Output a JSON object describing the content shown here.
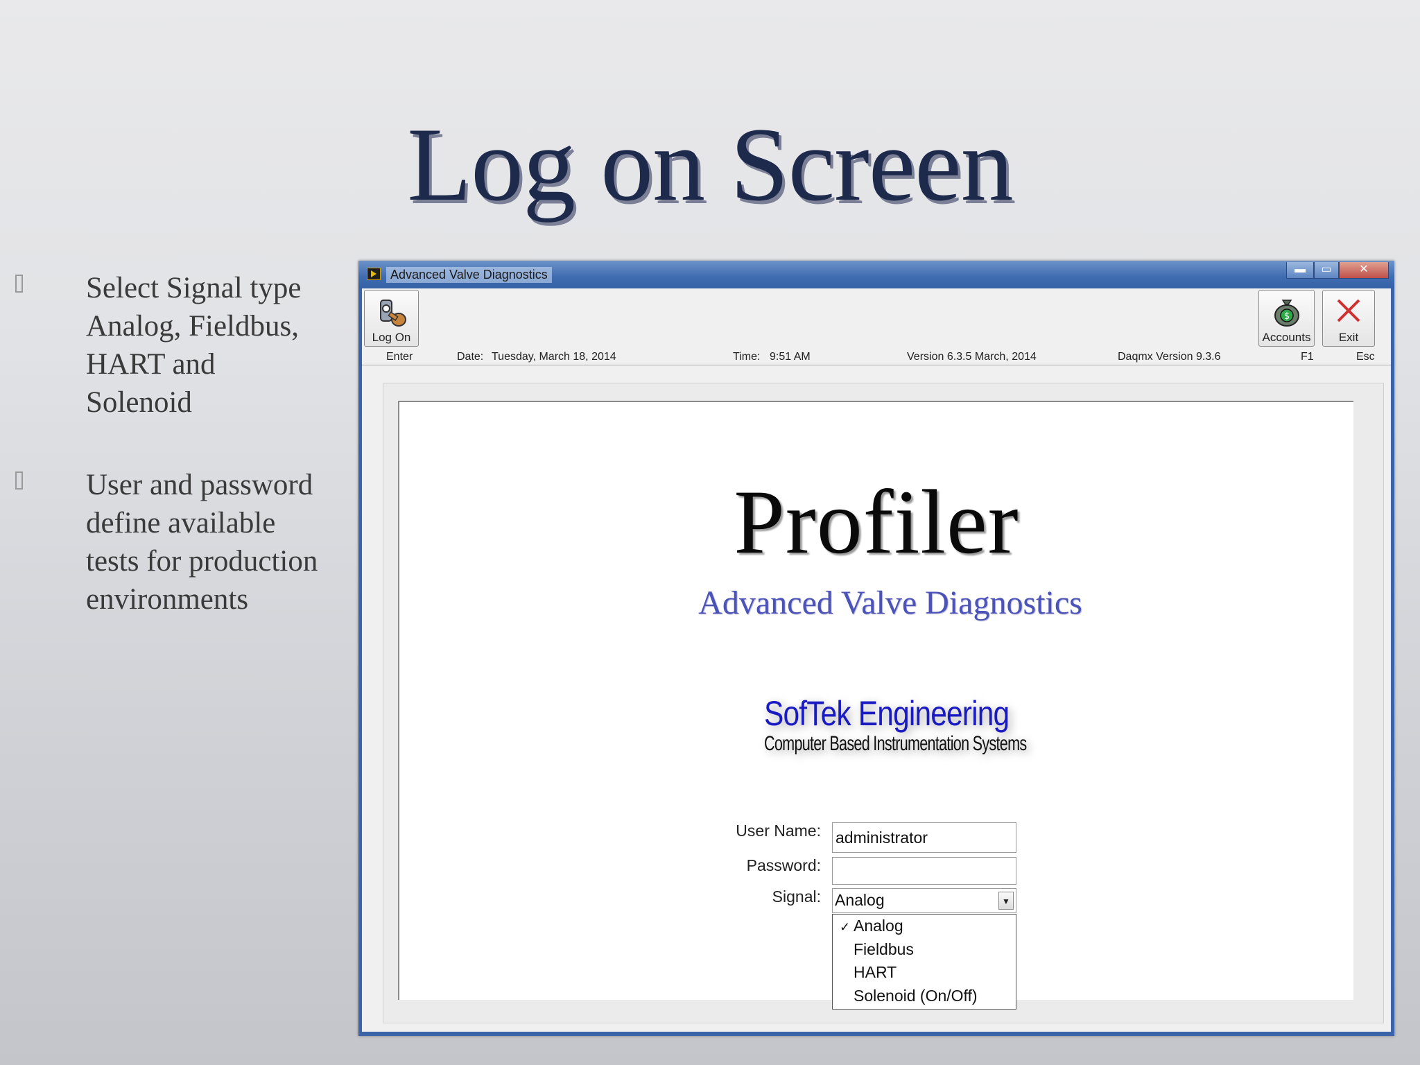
{
  "slide": {
    "title": "Log on Screen",
    "bullets": [
      {
        "lines": [
          "Select Signal type",
          "Analog, Fieldbus,",
          "HART and",
          "Solenoid"
        ]
      },
      {
        "lines": [
          "User and password",
          "define available",
          "tests for production",
          "environments"
        ]
      }
    ]
  },
  "window": {
    "title": "Advanced Valve Diagnostics",
    "controls": {
      "minimize": "▬",
      "maximize": "▭",
      "close": "✕"
    }
  },
  "toolbar": {
    "logon_label": "Log On",
    "logon_key": "Enter",
    "accounts_label": "Accounts",
    "accounts_key": "F1",
    "exit_label": "Exit",
    "exit_key": "Esc",
    "date_label": "Date:",
    "date_value": "Tuesday, March 18, 2014",
    "time_label": "Time:",
    "time_value": "9:51 AM",
    "version": "Version 6.3.5  March, 2014",
    "daqmx_version": "Daqmx Version 9.3.6"
  },
  "splash": {
    "product_name": "Profiler",
    "subtitle": "Advanced Valve Diagnostics",
    "company": "SofTek Engineering",
    "company_tagline": "Computer Based Instrumentation Systems"
  },
  "form": {
    "username_label": "User Name:",
    "username_value": "administrator",
    "password_label": "Password:",
    "password_value": "",
    "signal_label": "Signal:",
    "signal_value": "Analog",
    "signal_options": [
      "Analog",
      "Fieldbus",
      "HART",
      "Solenoid (On/Off)"
    ],
    "selected_check": "✓"
  },
  "colors": {
    "title_blue": "#1d2a4c",
    "window_frame": "#3a63a8",
    "subtitle_blue": "#4b53b8",
    "exit_red": "#d03030",
    "logo_blue": "#1a1ac2"
  },
  "icons": [
    "bullet-icon",
    "app-icon",
    "key-lock-icon",
    "money-bag-icon",
    "close-x-icon",
    "dropdown-arrow-icon",
    "check-icon"
  ]
}
